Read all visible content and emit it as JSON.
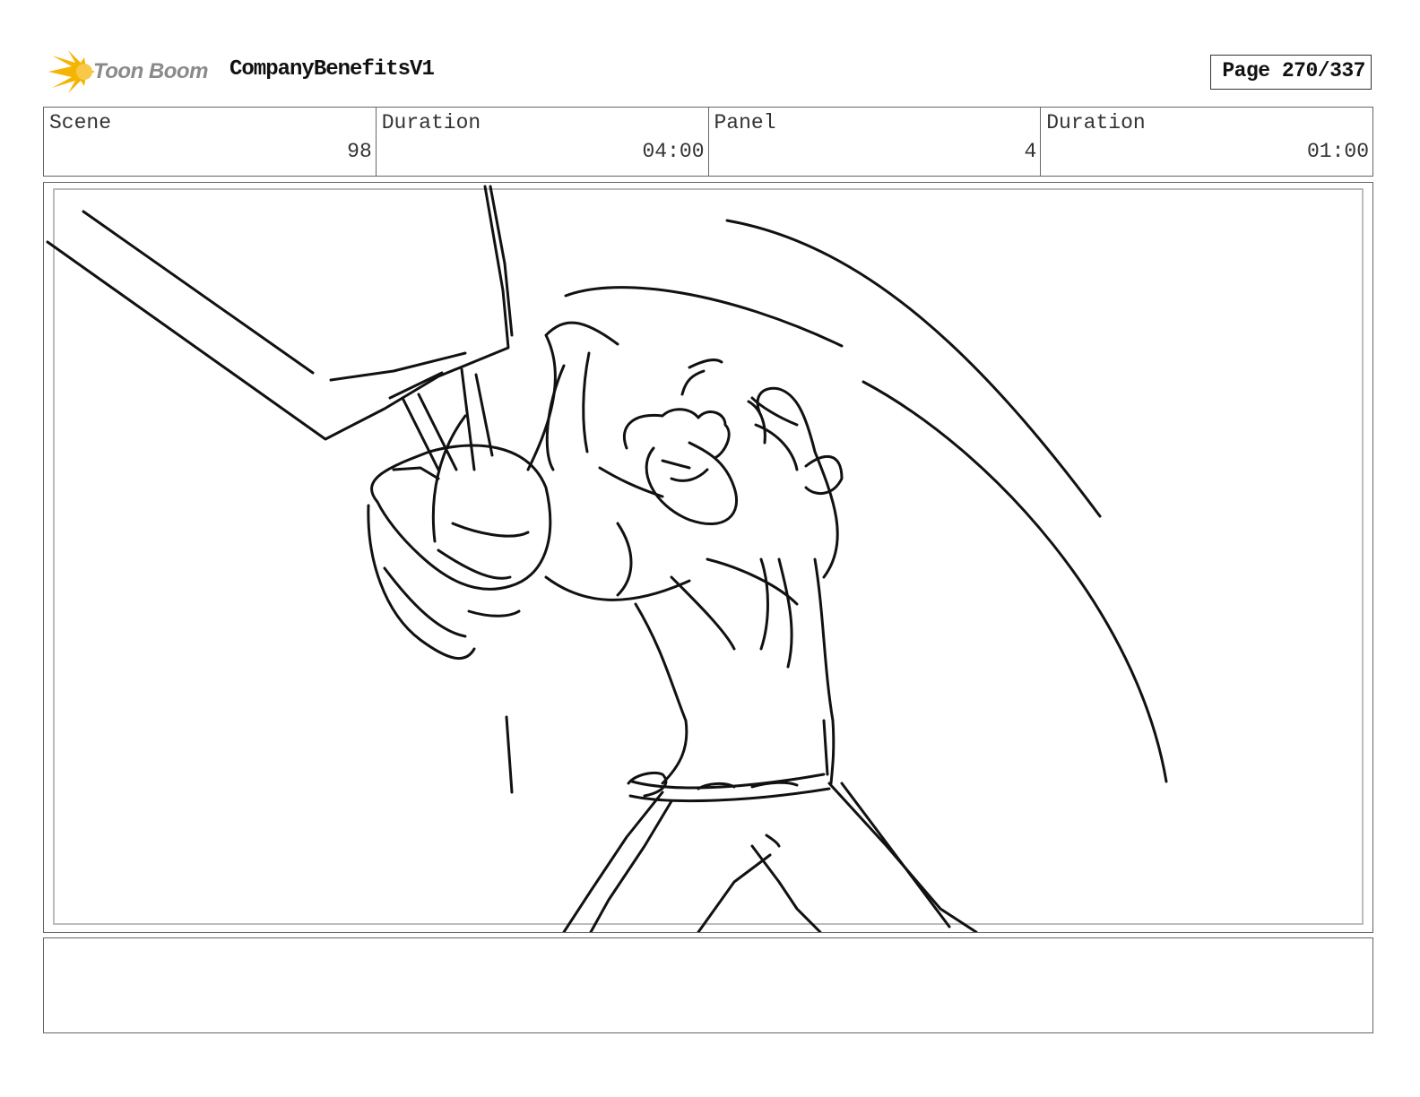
{
  "header": {
    "logo_text": "Toon Boom",
    "project_title": "CompanyBenefitsV1",
    "page_label": "Page 270/337"
  },
  "info": [
    {
      "label": "Scene",
      "value": "98"
    },
    {
      "label": "Duration",
      "value": "04:00"
    },
    {
      "label": "Panel",
      "value": "4"
    },
    {
      "label": "Duration",
      "value": "01:00"
    }
  ],
  "notes": {
    "text": ""
  },
  "colors": {
    "logo_star": "#f5b400",
    "logo_text": "#8a8a8a",
    "border": "#666666",
    "sketch_stroke": "#111111"
  },
  "icons": {
    "logo": "sun-burst-icon"
  }
}
